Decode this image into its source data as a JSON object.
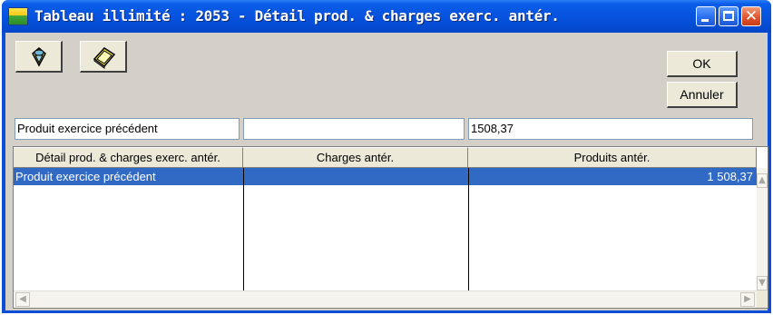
{
  "window": {
    "title": "Tableau illimité : 2053 - Détail prod. & charges exerc. antér.",
    "close_glyph": "✕"
  },
  "toolbar": {
    "tool1_icon": "paint-bucket-icon",
    "tool2_icon": "eraser-icon"
  },
  "buttons": {
    "ok_label": "OK",
    "cancel_label": "Annuler"
  },
  "fields": {
    "label_value": "Produit exercice précédent",
    "charges_value": "",
    "produits_value": "1508,37"
  },
  "table": {
    "columns": [
      "Détail prod. & charges exerc. antér.",
      "Charges antér.",
      "Produits antér."
    ],
    "rows": [
      {
        "detail": "Produit exercice précédent",
        "charges": "",
        "produits": "1 508,37",
        "selected": true
      }
    ]
  },
  "scrollbars": {
    "up": "▲",
    "down": "▼",
    "left": "◀",
    "right": "▶"
  },
  "colors": {
    "titlebar": "#0550dc",
    "selection": "#316ac5",
    "dialog": "#d4d0c8"
  }
}
